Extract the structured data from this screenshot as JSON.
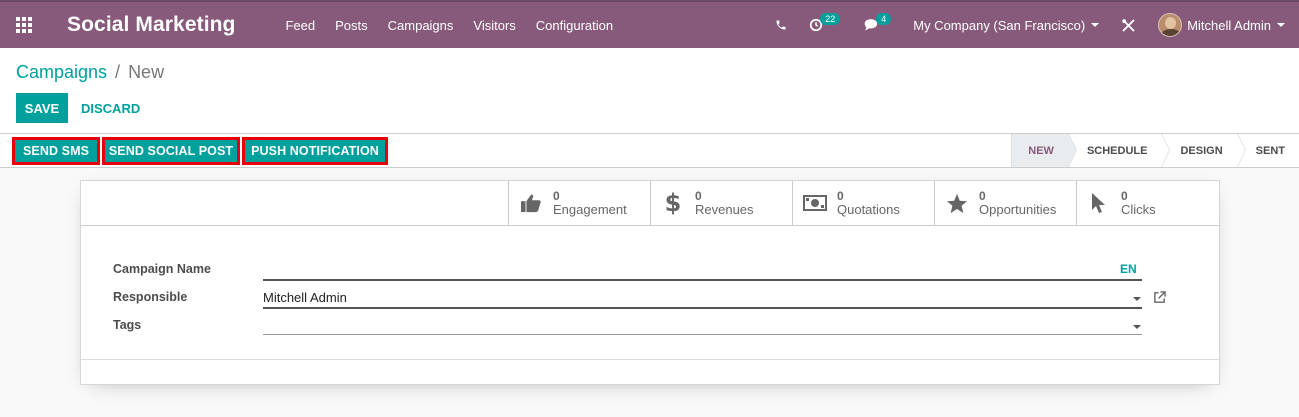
{
  "navbar": {
    "brand": "Social Marketing",
    "menu": [
      {
        "label": "Feed"
      },
      {
        "label": "Posts"
      },
      {
        "label": "Campaigns"
      },
      {
        "label": "Visitors"
      },
      {
        "label": "Configuration"
      }
    ],
    "activities_count": "22",
    "messages_count": "4",
    "company": "My Company (San Francisco)",
    "user": "Mitchell Admin"
  },
  "breadcrumb": {
    "parent": "Campaigns",
    "separator": "/",
    "current": "New"
  },
  "buttons": {
    "save": "SAVE",
    "discard": "DISCARD"
  },
  "actions": {
    "send_sms": "SEND SMS",
    "send_social_post": "SEND SOCIAL POST",
    "push_notification": "PUSH NOTIFICATION"
  },
  "stages": [
    {
      "label": "NEW",
      "active": true
    },
    {
      "label": "SCHEDULE",
      "active": false
    },
    {
      "label": "DESIGN",
      "active": false
    },
    {
      "label": "SENT",
      "active": false
    }
  ],
  "stats": [
    {
      "value": "0",
      "label": "Engagement",
      "icon": "thumbs-up-icon"
    },
    {
      "value": "0",
      "label": "Revenues",
      "icon": "dollar-icon"
    },
    {
      "value": "0",
      "label": "Quotations",
      "icon": "money-icon"
    },
    {
      "value": "0",
      "label": "Opportunities",
      "icon": "star-icon"
    },
    {
      "value": "0",
      "label": "Clicks",
      "icon": "cursor-icon"
    }
  ],
  "form": {
    "campaign_name_label": "Campaign Name",
    "campaign_name_value": "",
    "lang": "EN",
    "responsible_label": "Responsible",
    "responsible_value": "Mitchell Admin",
    "tags_label": "Tags",
    "tags_value": ""
  },
  "colors": {
    "brand": "#875a7b",
    "accent": "#00a09d",
    "highlight": "#e8000b"
  }
}
